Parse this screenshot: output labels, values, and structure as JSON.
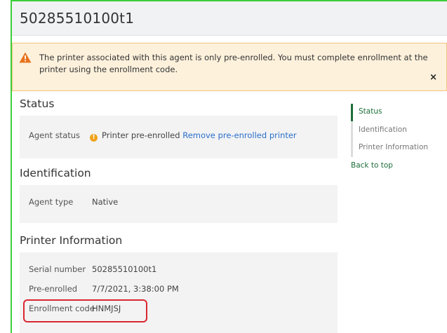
{
  "header": {
    "title": "50285510100t1"
  },
  "alert": {
    "message": "The printer associated with this agent is only pre-enrolled. You must complete enrollment at the printer using the enrollment code.",
    "close_label": "×"
  },
  "sections": {
    "status": {
      "title": "Status",
      "agent_status_label": "Agent status",
      "agent_status_value": "Printer pre-enrolled",
      "remove_link": "Remove pre-enrolled printer"
    },
    "identification": {
      "title": "Identification",
      "agent_type_label": "Agent type",
      "agent_type_value": "Native"
    },
    "printer_info": {
      "title": "Printer Information",
      "serial_label": "Serial number",
      "serial_value": "50285510100t1",
      "preenrolled_label": "Pre-enrolled",
      "preenrolled_value": "7/7/2021, 3:38:00 PM",
      "enrollment_label": "Enrollment code",
      "enrollment_value": "HNMJSJ"
    }
  },
  "toc": {
    "items": [
      "Status",
      "Identification",
      "Printer Information"
    ],
    "back_to_top": "Back to top"
  },
  "colors": {
    "accent_green": "#1d6e3a",
    "link_blue": "#2b6fc9",
    "warning_orange": "#f0a31c",
    "highlight_red": "#d9282f",
    "frame_green": "#3ccf3c"
  }
}
